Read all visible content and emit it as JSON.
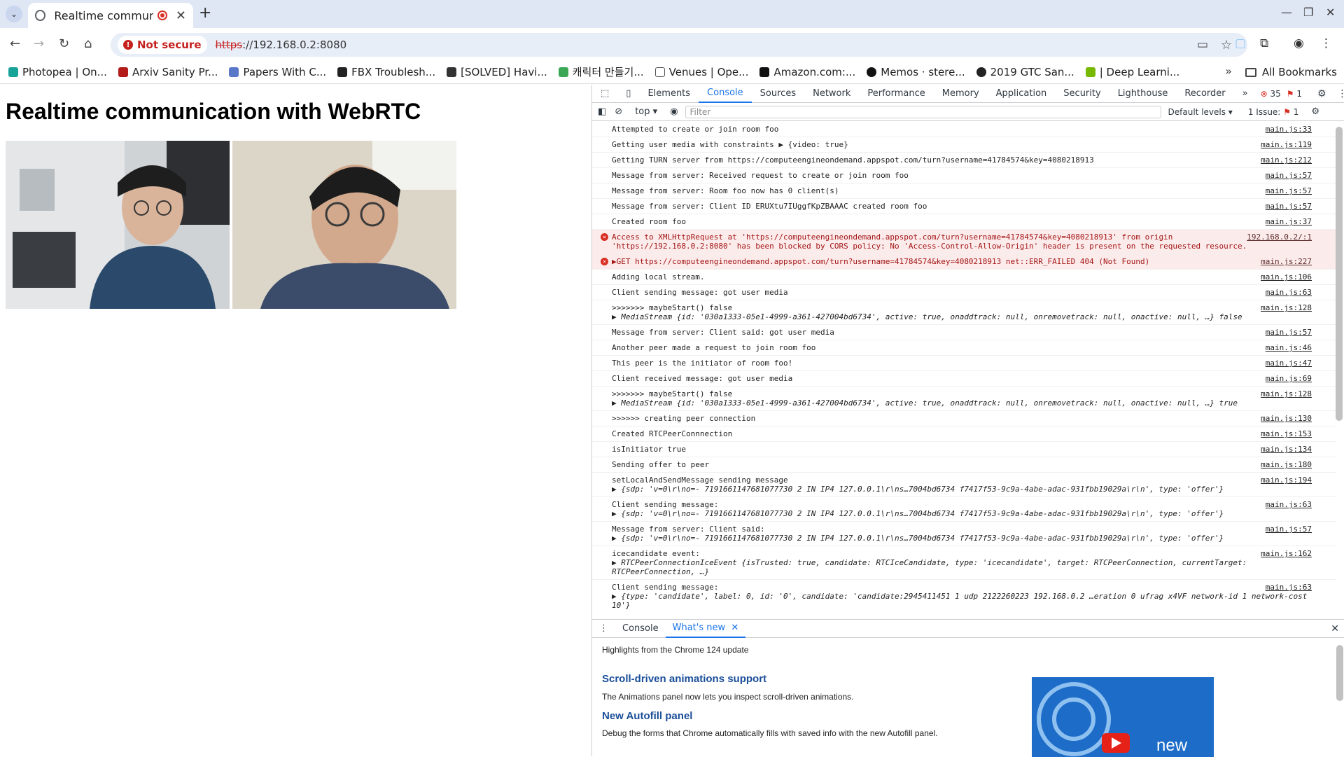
{
  "browser": {
    "tab_title": "Realtime communica",
    "not_secure": "Not secure",
    "url_scheme": "https",
    "url_rest": "://192.168.0.2:8080",
    "bookmarks": [
      "Photopea | On...",
      "Arxiv Sanity Pr...",
      "Papers With C...",
      "FBX Troublesh...",
      "[SOLVED] Havi...",
      "캐릭터 만들기...",
      "Venues | Ope...",
      "Amazon.com:...",
      "Memos · stere...",
      "2019 GTC San...",
      "| Deep Learni..."
    ],
    "all_bookmarks": "All Bookmarks"
  },
  "page": {
    "heading": "Realtime communication with WebRTC"
  },
  "devtools": {
    "tabs": [
      "Elements",
      "Console",
      "Sources",
      "Network",
      "Performance",
      "Memory",
      "Application",
      "Security",
      "Lighthouse",
      "Recorder"
    ],
    "active_tab": "Console",
    "error_count": "35",
    "issue_count": "1",
    "context": "top",
    "filter_placeholder": "Filter",
    "levels": "Default levels",
    "issues_label": "1 Issue:",
    "issues_num": "1",
    "drawer_tabs": [
      "Console",
      "What's new"
    ],
    "whatsnew": {
      "highlights": "Highlights from the Chrome 124 update",
      "h1": "Scroll-driven animations support",
      "p1": "The Animations panel now lets you inspect scroll-driven animations.",
      "h2": "New Autofill panel",
      "p2": "Debug the forms that Chrome automatically fills with saved info with the new Autofill panel.",
      "promo": "new"
    }
  },
  "console": [
    {
      "text": "Attempted to create or  join room foo",
      "src": "main.js:33"
    },
    {
      "text": "Getting user media with constraints  ▶ {video: true}",
      "src": "main.js:119"
    },
    {
      "text": "Getting TURN server from  https://computeengineondemand.appspot.com/turn?username=41784574&key=4080218913",
      "src": "main.js:212"
    },
    {
      "text": "Message from server: Received request to create or join room foo",
      "src": "main.js:57"
    },
    {
      "text": "Message from server: Room foo now has 0 client(s)",
      "src": "main.js:57"
    },
    {
      "text": "Message from server: Client ID ERUXtu7IUggfKpZBAAAC created room foo",
      "src": "main.js:57"
    },
    {
      "text": "Created room foo",
      "src": "main.js:37"
    },
    {
      "text": "Access to XMLHttpRequest at 'https://computeengineondemand.appspot.com/turn?username=41784574&key=4080218913' from origin 'https://192.168.0.2:8080' has been blocked by CORS policy: No 'Access-Control-Allow-Origin' header is present on the requested resource.",
      "src": "192.168.0.2/:1",
      "error": true
    },
    {
      "text": "▶GET https://computeengineondemand.appspot.com/turn?username=41784574&key=4080218913 net::ERR_FAILED 404 (Not Found)",
      "src": "main.js:227",
      "error": true
    },
    {
      "text": "Adding local stream.",
      "src": "main.js:106"
    },
    {
      "text": "Client sending message:  got user media",
      "src": "main.js:63"
    },
    {
      "text": ">>>>>>> maybeStart()  false",
      "sub": "▶ MediaStream {id: '030a1333-05e1-4999-a361-427004bd6734', active: true, onaddtrack: null, onremovetrack: null, onactive: null, …} false",
      "src": "main.js:128"
    },
    {
      "text": "Message from server: Client said:  got user media",
      "src": "main.js:57"
    },
    {
      "text": "Another peer made a request to join room foo",
      "src": "main.js:46"
    },
    {
      "text": "This peer is the initiator of room foo!",
      "src": "main.js:47"
    },
    {
      "text": "Client received message: got user media",
      "src": "main.js:69"
    },
    {
      "text": ">>>>>>> maybeStart()  false",
      "sub": "▶ MediaStream {id: '030a1333-05e1-4999-a361-427004bd6734', active: true, onaddtrack: null, onremovetrack: null, onactive: null, …} true",
      "src": "main.js:128"
    },
    {
      "text": ">>>>>> creating peer connection",
      "src": "main.js:130"
    },
    {
      "text": "Created RTCPeerConnnection",
      "src": "main.js:153"
    },
    {
      "text": "isInitiator true",
      "src": "main.js:134"
    },
    {
      "text": "Sending offer to peer",
      "src": "main.js:180"
    },
    {
      "text": "setLocalAndSendMessage sending message",
      "sub": "▶ {sdp: 'v=0\\r\\no=- 7191661147681077730 2 IN IP4 127.0.0.1\\r\\ns…7004bd6734 f7417f53-9c9a-4abe-adac-931fbb19029a\\r\\n', type: 'offer'}",
      "src": "main.js:194"
    },
    {
      "text": "Client sending message:",
      "sub": "▶ {sdp: 'v=0\\r\\no=- 7191661147681077730 2 IN IP4 127.0.0.1\\r\\ns…7004bd6734 f7417f53-9c9a-4abe-adac-931fbb19029a\\r\\n', type: 'offer'}",
      "src": "main.js:63"
    },
    {
      "text": "Message from server: Client said:",
      "sub": "▶ {sdp: 'v=0\\r\\no=- 7191661147681077730 2 IN IP4 127.0.0.1\\r\\ns…7004bd6734 f7417f53-9c9a-4abe-adac-931fbb19029a\\r\\n', type: 'offer'}",
      "src": "main.js:57"
    },
    {
      "text": "icecandidate event:",
      "sub": "▶ RTCPeerConnectionIceEvent {isTrusted: true, candidate: RTCIceCandidate, type: 'icecandidate', target: RTCPeerConnection, currentTarget: RTCPeerConnection, …}",
      "src": "main.js:162"
    },
    {
      "text": "Client sending message:",
      "sub": "▶ {type: 'candidate', label: 0, id: '0', candidate: 'candidate:2945411451 1 udp 2122260223 192.168.0.2 …eration 0 ufrag x4VF network-id 1 network-cost 10'}",
      "src": "main.js:63"
    }
  ]
}
